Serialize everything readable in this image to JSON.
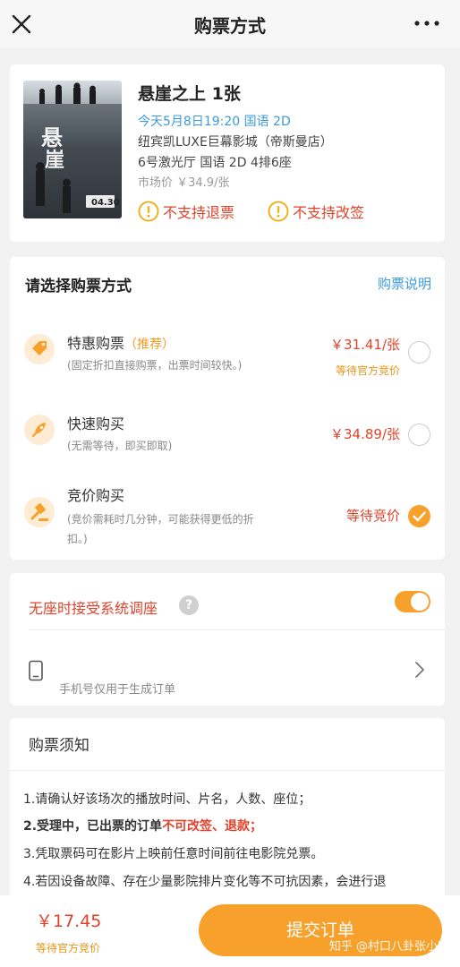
{
  "header": {
    "title": "购票方式"
  },
  "movie": {
    "title": "悬崖之上  1张",
    "showtime": "今天5月8日19:20 国语 2D",
    "cinema": "纽宾凯LUXE巨幕影城（帝斯曼店）",
    "hall_seat": "6号激光厅 国语 2D 4排6座",
    "market_price": "市场价 ￥34.9/张",
    "no_refund": "不支持退票",
    "no_change": "不支持改签",
    "poster_title": "悬崖之上",
    "poster_date": "04.30"
  },
  "purchase": {
    "section_title": "请选择购票方式",
    "help_link": "购票说明",
    "options": [
      {
        "name": "特惠购票",
        "tag": "（推荐）",
        "desc": "(固定折扣直接购票，出票时间较快。)",
        "price": "￥31.41/张",
        "status": "等待官方竞价",
        "selected": false
      },
      {
        "name": "快速购买",
        "tag": "",
        "desc": "(无需等待，即买即取)",
        "price": "￥34.89/张",
        "status": "",
        "selected": false
      },
      {
        "name": "竞价购买",
        "tag": "",
        "desc_line1": "(竞价需耗时几分钟，可能获得更低的折",
        "desc_line2": "扣。)",
        "price": "等待竞价",
        "status": "",
        "selected": true
      }
    ]
  },
  "seat": {
    "label": "无座时接受系统调座",
    "help_glyph": "?",
    "toggle_on": true,
    "phone_tip": "手机号仅用于生成订单"
  },
  "notice": {
    "title": "购票须知",
    "line1": "1.请确认好该场次的播放时间、片名，人数、座位；",
    "line2_prefix": "2.受理中，已出票的订单",
    "line2_highlight": "不可改签、退款；",
    "line3": "3.凭取票码可在影片上映前任意时间前往电影院兑票。",
    "line4": "4.若因设备故障、存在少量影院排片变化等不可抗因素，会进行退"
  },
  "footer": {
    "total_price": "￥17.45",
    "price_status": "等待官方竞价",
    "submit_label": "提交订单",
    "watermark": "知乎 @村口八卦张小哈"
  },
  "colors": {
    "accent_orange": "#f7a12c",
    "link_blue": "#3b9bd9",
    "alert_red": "#e0432b"
  }
}
